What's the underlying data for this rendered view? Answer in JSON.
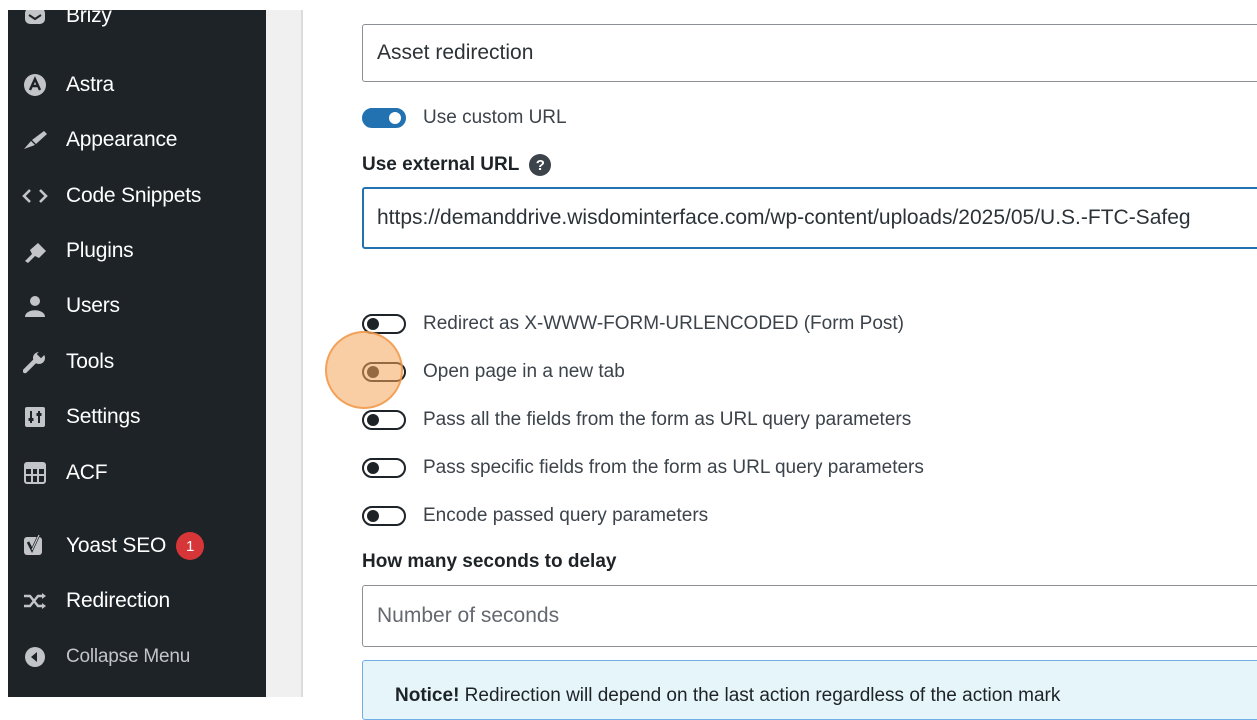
{
  "sidebar": {
    "items": [
      {
        "label": "Brizy",
        "icon": "brizy-icon"
      },
      {
        "label": "Astra",
        "icon": "astra-icon"
      },
      {
        "label": "Appearance",
        "icon": "paintbrush-icon"
      },
      {
        "label": "Code Snippets",
        "icon": "code-icon"
      },
      {
        "label": "Plugins",
        "icon": "plug-icon"
      },
      {
        "label": "Users",
        "icon": "user-icon"
      },
      {
        "label": "Tools",
        "icon": "wrench-icon"
      },
      {
        "label": "Settings",
        "icon": "settings-sliders-icon"
      },
      {
        "label": "ACF",
        "icon": "table-grid-icon"
      },
      {
        "label": "Yoast SEO",
        "icon": "yoast-icon",
        "badge": "1"
      },
      {
        "label": "Redirection",
        "icon": "shuffle-icon"
      }
    ],
    "collapse_label": "Collapse Menu"
  },
  "form": {
    "redirect_name_value": "Asset redirection",
    "use_custom_url_label": "Use custom URL",
    "use_custom_url_on": true,
    "external_url_label": "Use external URL",
    "external_url_value": "https://demanddrive.wisdominterface.com/wp-content/uploads/2025/05/U.S.-FTC-Safeg",
    "toggles": [
      {
        "label": "Redirect as X-WWW-FORM-URLENCODED (Form Post)",
        "on": false
      },
      {
        "label": "Open page in a new tab",
        "on": false
      },
      {
        "label": "Pass all the fields from the form as URL query parameters",
        "on": false
      },
      {
        "label": "Pass specific fields from the form as URL query parameters",
        "on": false
      },
      {
        "label": "Encode passed query parameters",
        "on": false
      }
    ],
    "delay_label": "How many seconds to delay",
    "delay_placeholder": "Number of seconds",
    "notice_strong": "Notice!",
    "notice_text": " Redirection will depend on the last action regardless of the action mark"
  },
  "colors": {
    "sidebar_bg": "#1d2327",
    "accent": "#2271b1",
    "badge": "#d63638",
    "click_highlight": "#f5a65a"
  }
}
